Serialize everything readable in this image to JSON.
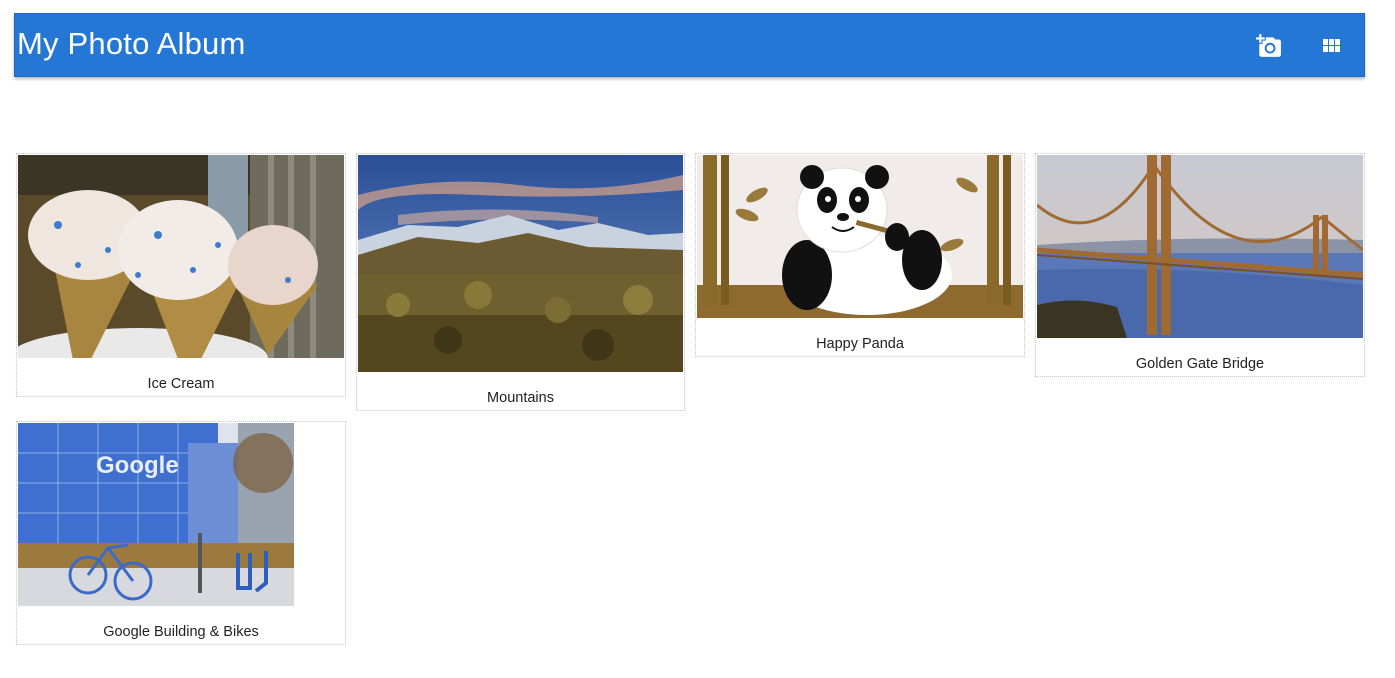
{
  "header": {
    "title": "My Photo Album",
    "add_photo_icon": "add-a-photo-icon",
    "view_grid_icon": "view-module-icon",
    "bar_color": "#2577d5"
  },
  "photos": [
    {
      "caption": "Ice Cream"
    },
    {
      "caption": "Mountains"
    },
    {
      "caption": "Happy Panda"
    },
    {
      "caption": "Golden Gate Bridge"
    },
    {
      "caption": "Google Building & Bikes"
    }
  ]
}
